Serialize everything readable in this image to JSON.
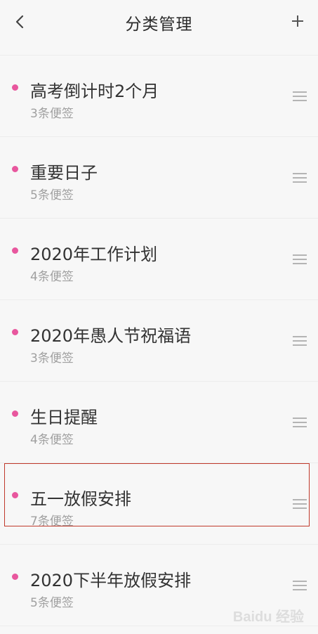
{
  "header": {
    "title": "分类管理",
    "back_icon": "chevron-left-icon",
    "add_icon": "plus-icon"
  },
  "accent_color": "#e8579e",
  "categories": [
    {
      "name": "高考倒计时2个月",
      "count": "3条便签"
    },
    {
      "name": "重要日子",
      "count": "5条便签"
    },
    {
      "name": "2020年工作计划",
      "count": "4条便签"
    },
    {
      "name": "2020年愚人节祝福语",
      "count": "3条便签"
    },
    {
      "name": "生日提醒",
      "count": "4条便签"
    },
    {
      "name": "五一放假安排",
      "count": "7条便签",
      "selected": true
    },
    {
      "name": "2020下半年放假安排",
      "count": "5条便签"
    }
  ],
  "watermark": "Baidu 经验"
}
